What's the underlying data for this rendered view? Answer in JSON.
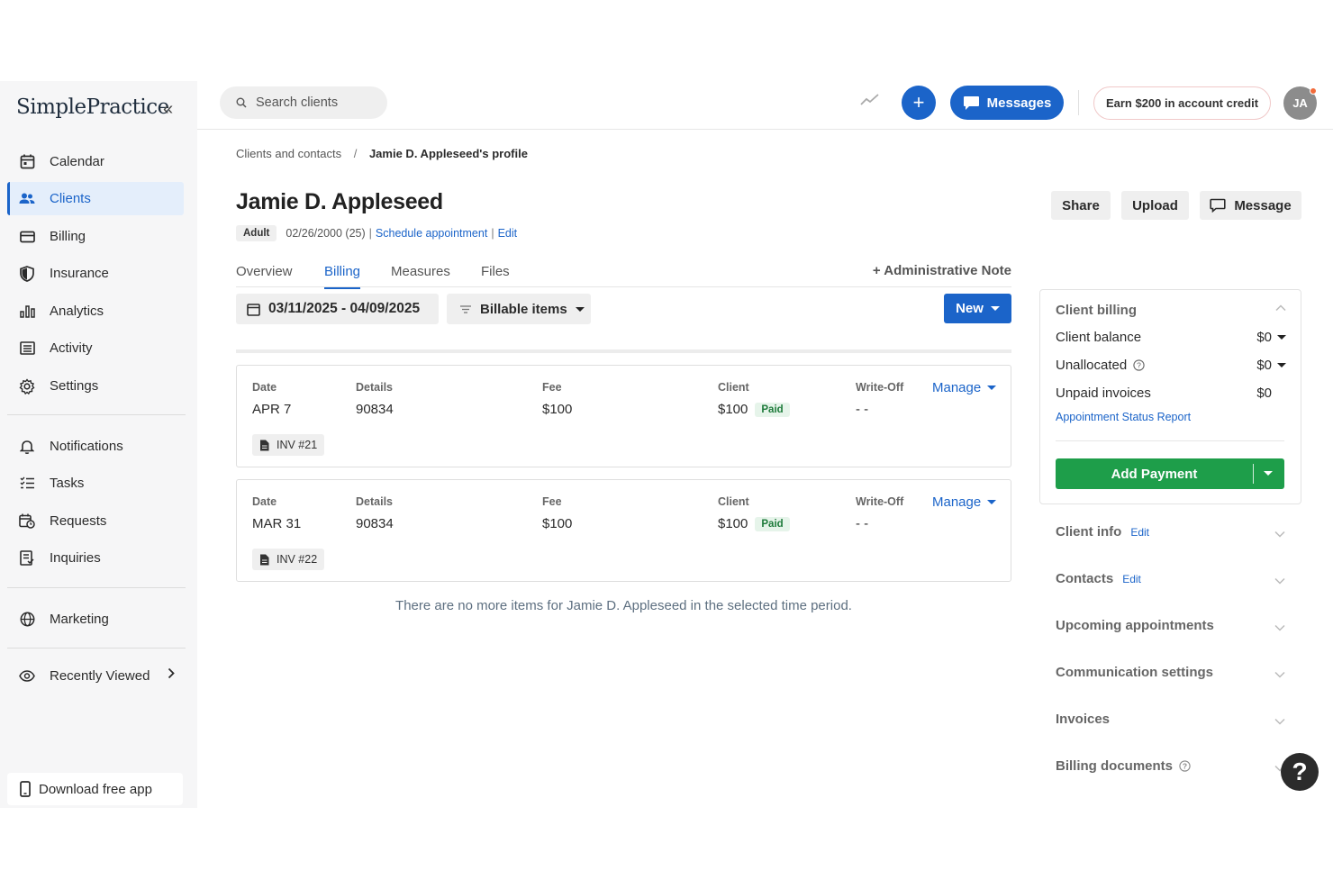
{
  "app": {
    "logo": "SimplePractice"
  },
  "sidebar": {
    "items": [
      {
        "label": "Calendar",
        "icon": "calendar-icon"
      },
      {
        "label": "Clients",
        "icon": "users-icon",
        "active": true
      },
      {
        "label": "Billing",
        "icon": "credit-card-icon"
      },
      {
        "label": "Insurance",
        "icon": "shield-icon"
      },
      {
        "label": "Analytics",
        "icon": "bar-chart-icon"
      },
      {
        "label": "Activity",
        "icon": "list-icon"
      },
      {
        "label": "Settings",
        "icon": "gear-icon"
      }
    ],
    "items2": [
      {
        "label": "Notifications",
        "icon": "bell-icon"
      },
      {
        "label": "Tasks",
        "icon": "checklist-icon"
      },
      {
        "label": "Requests",
        "icon": "calendar-clock-icon"
      },
      {
        "label": "Inquiries",
        "icon": "clipboard-icon"
      }
    ],
    "marketing": "Marketing",
    "recently_viewed": "Recently Viewed",
    "download_app": "Download free app"
  },
  "topbar": {
    "search_placeholder": "Search clients",
    "messages_label": "Messages",
    "plus_label": "+",
    "earn_label": "Earn $200 in account credit",
    "avatar_initials": "JA"
  },
  "breadcrumb": {
    "parent": "Clients and contacts",
    "separator": "/",
    "current": "Jamie D. Appleseed's profile"
  },
  "client": {
    "name": "Jamie D. Appleseed",
    "badge": "Adult",
    "dob": "02/26/2000 (25)",
    "schedule_link": "Schedule appointment",
    "edit_link": "Edit"
  },
  "actions": {
    "share": "Share",
    "upload": "Upload",
    "message": "Message"
  },
  "tabs": [
    {
      "label": "Overview"
    },
    {
      "label": "Billing",
      "active": true
    },
    {
      "label": "Measures"
    },
    {
      "label": "Files"
    }
  ],
  "admin_note": "+ Administrative Note",
  "filters": {
    "date_range": "03/11/2025 - 04/09/2025",
    "billable": "Billable items",
    "new_label": "New"
  },
  "columns": {
    "date": "Date",
    "details": "Details",
    "fee": "Fee",
    "client": "Client",
    "writeoff": "Write-Off"
  },
  "items": [
    {
      "date": "APR 7",
      "details": "90834",
      "fee": "$100",
      "client": "$100",
      "status": "Paid",
      "writeoff": "- -",
      "manage": "Manage",
      "invoice": "INV #21"
    },
    {
      "date": "MAR 31",
      "details": "90834",
      "fee": "$100",
      "client": "$100",
      "status": "Paid",
      "writeoff": "- -",
      "manage": "Manage",
      "invoice": "INV #22"
    }
  ],
  "no_more": "There are no more items for Jamie D. Appleseed in the selected time period.",
  "billing_panel": {
    "title": "Client billing",
    "balance_label": "Client balance",
    "balance_value": "$0",
    "unallocated_label": "Unallocated",
    "unallocated_value": "$0",
    "unpaid_label": "Unpaid invoices",
    "unpaid_value": "$0",
    "report_link": "Appointment Status Report",
    "add_payment": "Add Payment"
  },
  "sections": {
    "client_info": "Client info",
    "client_info_edit": "Edit",
    "contacts": "Contacts",
    "contacts_edit": "Edit",
    "upcoming": "Upcoming appointments",
    "communication": "Communication settings",
    "invoices": "Invoices",
    "billing_docs": "Billing documents"
  },
  "help_label": "?",
  "colors": {
    "primary": "#1b64c9",
    "success": "#1e9e4a",
    "paid_bg": "#e6f4ea"
  }
}
